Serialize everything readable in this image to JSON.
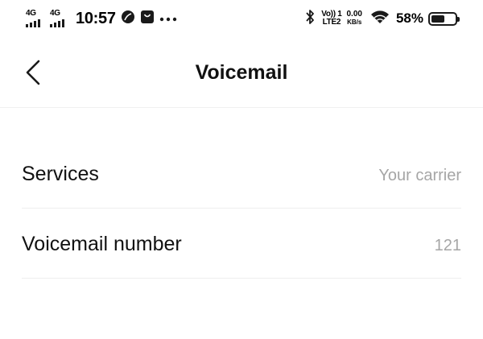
{
  "status_bar": {
    "sim1_network": "4G",
    "sim2_network": "4G",
    "time": "10:57",
    "volte_top": "Vo)) 1",
    "volte_bottom": "LTE2",
    "speed_value": "0.00",
    "speed_unit": "KB/s",
    "battery_percent": "58%",
    "battery_level": 0.58
  },
  "header": {
    "title": "Voicemail"
  },
  "settings": [
    {
      "label": "Services",
      "value": "Your carrier"
    },
    {
      "label": "Voicemail number",
      "value": "121"
    }
  ],
  "icons": {
    "back": "chevron-left-icon",
    "status": [
      "signal-bars-icon",
      "leaf-icon",
      "bag-icon",
      "more-dots-icon",
      "bluetooth-icon",
      "wifi-icon",
      "battery-icon"
    ]
  },
  "colors": {
    "text": "#111111",
    "value_text": "#a6a6a6",
    "divider": "#eeeeee"
  }
}
